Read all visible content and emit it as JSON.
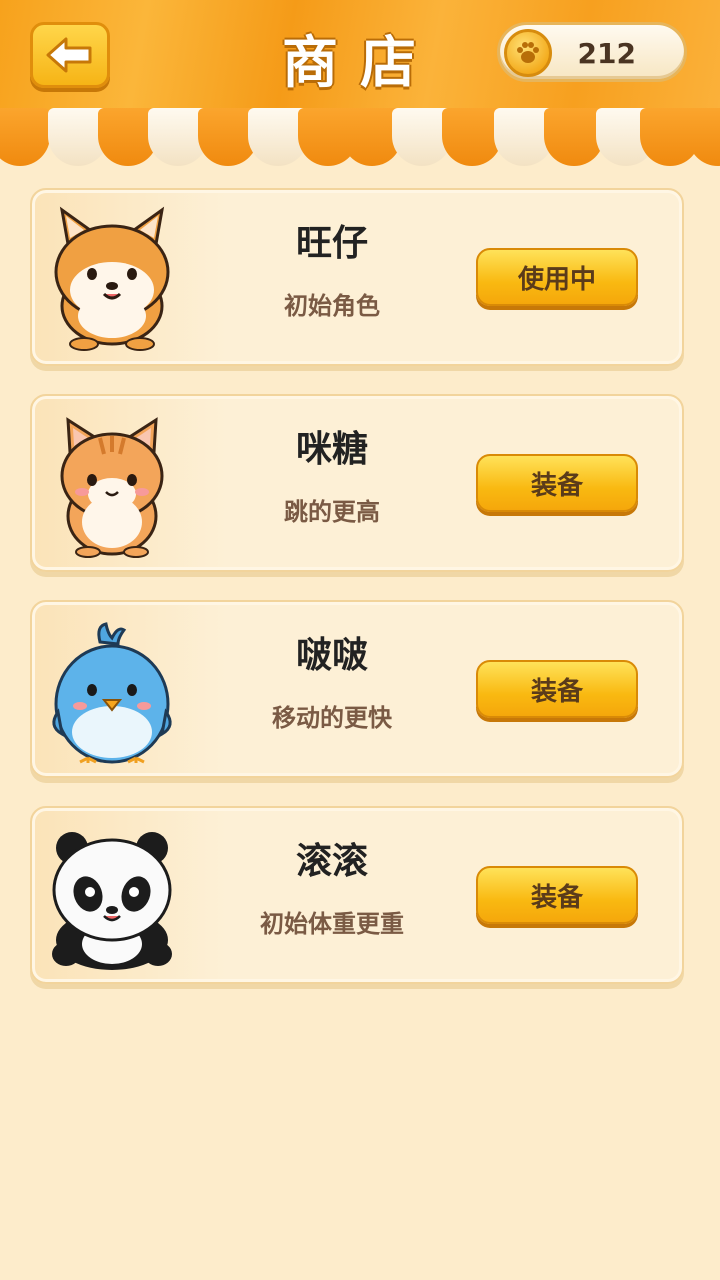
{
  "header": {
    "title": "商店",
    "back_icon": "back-arrow-icon",
    "coins": "212",
    "coin_icon": "paw-coin-icon"
  },
  "colors": {
    "accent": "#f7a21c",
    "button": "#f9b911",
    "background": "#fdeccb"
  },
  "characters": [
    {
      "name": "旺仔",
      "desc": "初始角色",
      "action": "使用中",
      "icon": "shiba-dog-icon"
    },
    {
      "name": "咪糖",
      "desc": "跳的更高",
      "action": "装备",
      "icon": "orange-cat-icon"
    },
    {
      "name": "啵啵",
      "desc": "移动的更快",
      "action": "装备",
      "icon": "blue-bird-icon"
    },
    {
      "name": "滚滚",
      "desc": "初始体重更重",
      "action": "装备",
      "icon": "panda-icon"
    }
  ]
}
